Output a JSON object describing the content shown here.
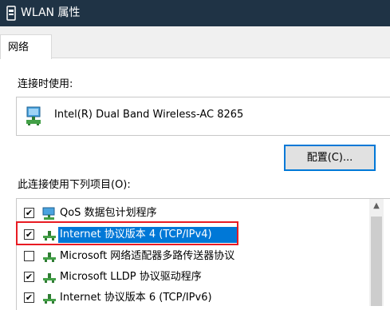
{
  "window": {
    "title": "WLAN 属性"
  },
  "tabs": [
    {
      "label": "网络"
    }
  ],
  "connect_using": {
    "label": "连接时使用:",
    "adapter_name": "Intel(R) Dual Band Wireless-AC 8265",
    "configure_button_label": "配置(C)..."
  },
  "items_section": {
    "label": "此连接使用下列项目(O):",
    "items": [
      {
        "label": "QoS 数据包计划程序",
        "checked": true,
        "icon": "qos-scheduler-icon"
      },
      {
        "label": "Internet 协议版本 4 (TCP/IPv4)",
        "checked": true,
        "selected": true,
        "icon": "network-protocol-icon"
      },
      {
        "label": "Microsoft 网络适配器多路传送器协议",
        "checked": false,
        "icon": "network-protocol-icon"
      },
      {
        "label": "Microsoft LLDP 协议驱动程序",
        "checked": true,
        "icon": "network-protocol-icon"
      },
      {
        "label": "Internet 协议版本 6 (TCP/IPv6)",
        "checked": true,
        "icon": "network-protocol-icon"
      }
    ]
  },
  "colors": {
    "titlebar": "#1f3345",
    "selection": "#0078d7",
    "highlight": "#e81b23"
  }
}
